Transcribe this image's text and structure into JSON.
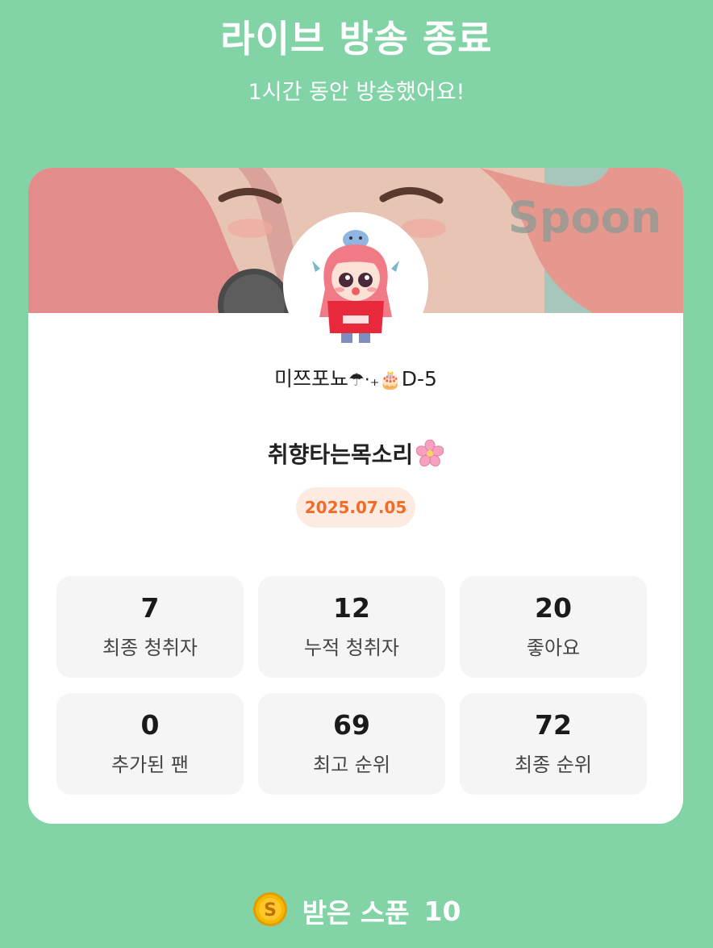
{
  "header": {
    "title": "라이브 방송 종료",
    "subtitle": "1시간 동안 방송했어요!"
  },
  "banner": {
    "watermark": "Spoon"
  },
  "profile": {
    "nickname": "미쯔포뇨",
    "nickname_emoji": "☂︎·₊🎂",
    "nickname_suffix": "D-5"
  },
  "live": {
    "title": "취향타는목소리",
    "title_icon": "cherry-blossom-icon",
    "date": "2025.07.05"
  },
  "stats": [
    {
      "value": "7",
      "label": "최종 청취자"
    },
    {
      "value": "12",
      "label": "누적 청취자"
    },
    {
      "value": "20",
      "label": "좋아요"
    },
    {
      "value": "0",
      "label": "추가된 팬"
    },
    {
      "value": "69",
      "label": "최고 순위"
    },
    {
      "value": "72",
      "label": "최종 순위"
    }
  ],
  "footer": {
    "icon": "spoon-coin-icon",
    "label": "받은 스푼",
    "count": "10"
  },
  "colors": {
    "background": "#82d4a6",
    "card": "#ffffff",
    "date_accent": "#f26b27",
    "date_bg": "#fdebe2",
    "stat_bg": "#f5f5f5",
    "coin": "#f5b800"
  }
}
